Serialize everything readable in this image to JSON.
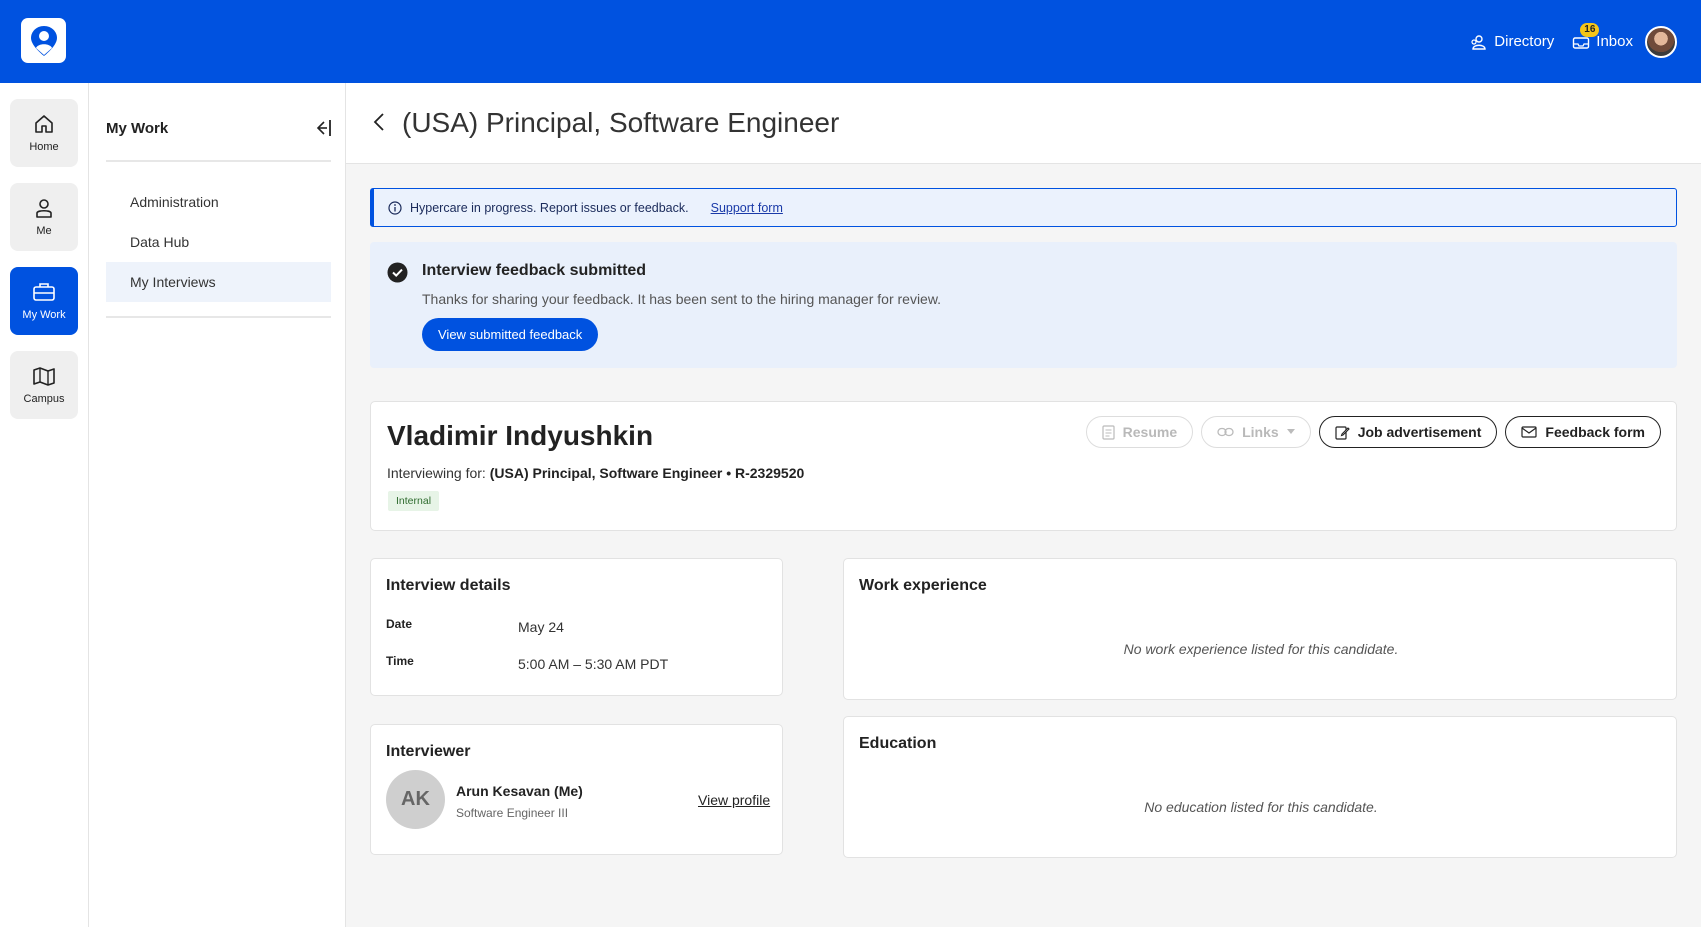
{
  "topbar": {
    "directory_label": "Directory",
    "inbox_label": "Inbox",
    "inbox_count": "16",
    "brand_color": "#0052e0"
  },
  "rail": {
    "items": [
      {
        "label": "Home",
        "icon": "home-icon"
      },
      {
        "label": "Me",
        "icon": "user-icon"
      },
      {
        "label": "My Work",
        "icon": "briefcase-icon"
      },
      {
        "label": "Campus",
        "icon": "map-icon"
      }
    ]
  },
  "subnav": {
    "title": "My Work",
    "items": [
      {
        "label": "Administration"
      },
      {
        "label": "Data Hub"
      },
      {
        "label": "My Interviews"
      }
    ]
  },
  "page": {
    "title": "(USA) Principal, Software Engineer"
  },
  "banner": {
    "text": "Hypercare in progress. Report issues or feedback.",
    "link": "Support form"
  },
  "success": {
    "title": "Interview feedback submitted",
    "message": "Thanks for sharing your feedback. It has been sent to the hiring manager for review.",
    "button": "View submitted feedback"
  },
  "candidate": {
    "name": "Vladimir Indyushkin",
    "for_prefix": "Interviewing for:",
    "for_value": "(USA) Principal, Software Engineer • R-2329520",
    "tag": "Internal",
    "actions": {
      "resume": "Resume",
      "links": "Links",
      "job_ad": "Job advertisement",
      "feedback": "Feedback form"
    }
  },
  "details": {
    "title": "Interview details",
    "date_label": "Date",
    "date_value": "May 24",
    "time_label": "Time",
    "time_value": "5:00 AM – 5:30 AM PDT"
  },
  "interviewer": {
    "title": "Interviewer",
    "initials": "AK",
    "name": "Arun Kesavan (Me)",
    "role": "Software Engineer III",
    "link": "View profile"
  },
  "work": {
    "title": "Work experience",
    "empty": "No work experience listed for this candidate."
  },
  "education": {
    "title": "Education",
    "empty": "No education listed for this candidate."
  }
}
